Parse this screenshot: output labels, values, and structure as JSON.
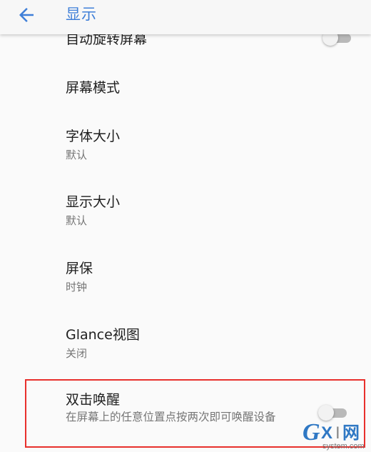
{
  "appbar": {
    "title": "显示",
    "back_icon": "arrow-left-icon"
  },
  "settings": {
    "auto_rotate": {
      "title": "自动旋转屏幕",
      "enabled": false
    },
    "screen_mode": {
      "title": "屏幕模式"
    },
    "font_size": {
      "title": "字体大小",
      "summary": "默认"
    },
    "display_size": {
      "title": "显示大小",
      "summary": "默认"
    },
    "screensaver": {
      "title": "屏保",
      "summary": "时钟"
    },
    "glance": {
      "title": "Glance视图",
      "summary": "关闭"
    },
    "double_tap_wake": {
      "title": "双击唤醒",
      "summary": "在屏幕上的任意位置点按两次即可唤醒设备",
      "enabled": false
    }
  },
  "watermark": {
    "logo": "GXI网",
    "domain": "system.com"
  },
  "colors": {
    "accent": "#3f7fd8",
    "highlight": "#e8302c",
    "primary_text": "#202020",
    "secondary_text": "#757575",
    "background": "#fafafa"
  }
}
